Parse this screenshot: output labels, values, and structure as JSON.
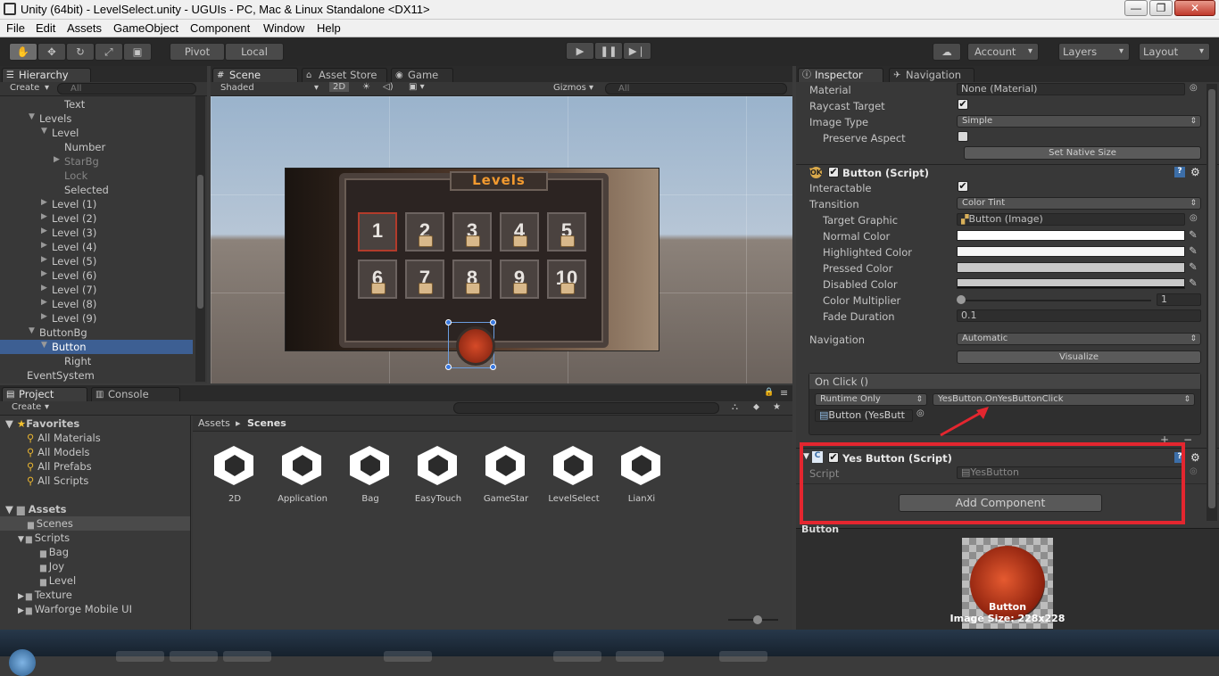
{
  "window": {
    "title": "Unity (64bit) - LevelSelect.unity - UGUIs - PC, Mac & Linux Standalone <DX11>"
  },
  "menu": [
    "File",
    "Edit",
    "Assets",
    "GameObject",
    "Component",
    "Window",
    "Help"
  ],
  "toolbar": {
    "pivot": "Pivot",
    "local": "Local",
    "account": "Account",
    "layers": "Layers",
    "layout": "Layout"
  },
  "hierarchy": {
    "tab": "Hierarchy",
    "create": "Create",
    "search_placeholder": "All",
    "items": [
      {
        "label": "Text",
        "indent": 3
      },
      {
        "label": "Levels",
        "indent": 1,
        "arrow": "▼"
      },
      {
        "label": "Level",
        "indent": 2,
        "arrow": "▼"
      },
      {
        "label": "Number",
        "indent": 3
      },
      {
        "label": "StarBg",
        "indent": 3,
        "arrow": "▶",
        "dim": true
      },
      {
        "label": "Lock",
        "indent": 3,
        "dim": true
      },
      {
        "label": "Selected",
        "indent": 3
      },
      {
        "label": "Level (1)",
        "indent": 2,
        "arrow": "▶"
      },
      {
        "label": "Level (2)",
        "indent": 2,
        "arrow": "▶"
      },
      {
        "label": "Level (3)",
        "indent": 2,
        "arrow": "▶"
      },
      {
        "label": "Level (4)",
        "indent": 2,
        "arrow": "▶"
      },
      {
        "label": "Level (5)",
        "indent": 2,
        "arrow": "▶"
      },
      {
        "label": "Level (6)",
        "indent": 2,
        "arrow": "▶"
      },
      {
        "label": "Level (7)",
        "indent": 2,
        "arrow": "▶"
      },
      {
        "label": "Level (8)",
        "indent": 2,
        "arrow": "▶"
      },
      {
        "label": "Level (9)",
        "indent": 2,
        "arrow": "▶"
      },
      {
        "label": "ButtonBg",
        "indent": 1,
        "arrow": "▼"
      },
      {
        "label": "Button",
        "indent": 2,
        "arrow": "▼",
        "selected": true
      },
      {
        "label": "Right",
        "indent": 3
      },
      {
        "label": "EventSystem",
        "indent": 0
      }
    ]
  },
  "scene": {
    "tabs": [
      "Scene",
      "Asset Store",
      "Game"
    ],
    "shaded": "Shaded",
    "mode2d": "2D",
    "gizmos": "Gizmos",
    "search_placeholder": "All",
    "level_title": "Levels",
    "levels": [
      {
        "n": "1",
        "locked": false,
        "selected": true
      },
      {
        "n": "2",
        "locked": true
      },
      {
        "n": "3",
        "locked": true
      },
      {
        "n": "4",
        "locked": true
      },
      {
        "n": "5",
        "locked": true
      },
      {
        "n": "6",
        "locked": true
      },
      {
        "n": "7",
        "locked": true
      },
      {
        "n": "8",
        "locked": true
      },
      {
        "n": "9",
        "locked": true
      },
      {
        "n": "10",
        "locked": true
      }
    ]
  },
  "inspector": {
    "tabs": [
      "Inspector",
      "Navigation"
    ],
    "material_label": "Material",
    "material_value": "None (Material)",
    "raycast_label": "Raycast Target",
    "image_type_label": "Image Type",
    "image_type_value": "Simple",
    "preserve_label": "Preserve Aspect",
    "native_size": "Set Native Size",
    "button_script": "Button (Script)",
    "interactable": "Interactable",
    "transition": "Transition",
    "transition_value": "Color Tint",
    "target_graphic": "Target Graphic",
    "target_graphic_value": "Button (Image)",
    "normal": "Normal Color",
    "highlighted": "Highlighted Color",
    "pressed": "Pressed Color",
    "disabled": "Disabled Color",
    "multiplier": "Color Multiplier",
    "multiplier_value": "1",
    "fade": "Fade Duration",
    "fade_value": "0.1",
    "navigation": "Navigation",
    "navigation_value": "Automatic",
    "visualize": "Visualize",
    "onclick": "On Click ()",
    "runtime": "Runtime Only",
    "method": "YesButton.OnYesButtonClick",
    "obj": "Button (YesButt",
    "yes_script": "Yes Button (Script)",
    "script_label": "Script",
    "script_value": "YesButton",
    "add_component": "Add Component",
    "colors": {
      "normal": "#ffffff",
      "highlighted": "#f5f5f5",
      "pressed": "#c8c8c8",
      "disabled": "#c8c8c8"
    },
    "highlight_box_color": "#e4262f"
  },
  "project": {
    "tabs": [
      "Project",
      "Console"
    ],
    "create": "Create",
    "favorites_label": "Favorites",
    "favorites": [
      "All Materials",
      "All Models",
      "All Prefabs",
      "All Scripts"
    ],
    "assets_label": "Assets",
    "tree": [
      {
        "label": "Scenes",
        "indent": 1,
        "selected": true
      },
      {
        "label": "Scripts",
        "indent": 1,
        "arrow": "▼"
      },
      {
        "label": "Bag",
        "indent": 2
      },
      {
        "label": "Joy",
        "indent": 2
      },
      {
        "label": "Level",
        "indent": 2
      },
      {
        "label": "Texture",
        "indent": 1,
        "arrow": "▶"
      },
      {
        "label": "Warforge Mobile UI",
        "indent": 1,
        "arrow": "▶"
      }
    ],
    "breadcrumb_root": "Assets",
    "breadcrumb_sep": "▸",
    "breadcrumb_current": "Scenes",
    "scenes": [
      "2D",
      "Application",
      "Bag",
      "EasyTouch",
      "GameStar",
      "LevelSelect",
      "LianXi"
    ]
  },
  "preview": {
    "header": "Button",
    "name": "Button",
    "size": "Image Size: 228x228"
  }
}
